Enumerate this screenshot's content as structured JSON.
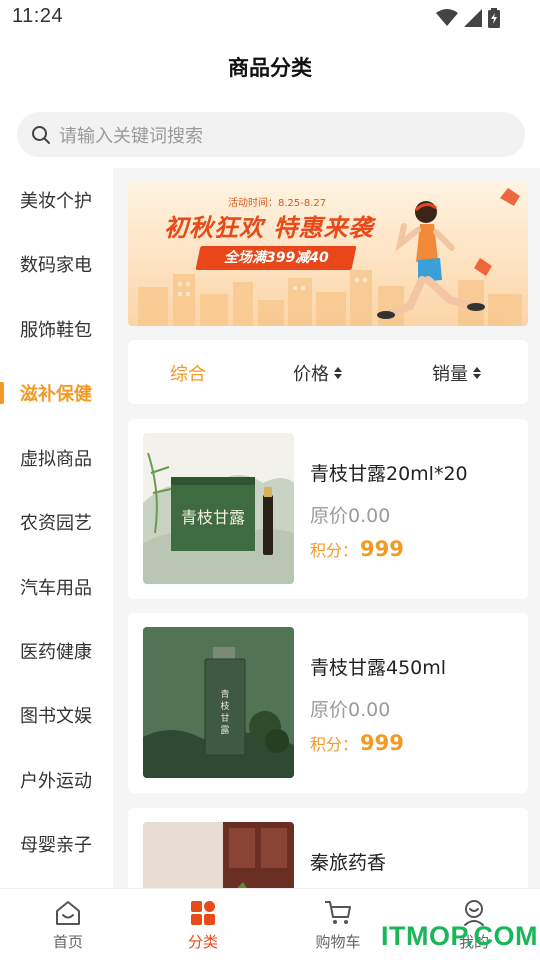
{
  "status": {
    "time": "11:24"
  },
  "header": {
    "title": "商品分类"
  },
  "search": {
    "placeholder": "请输入关键词搜索"
  },
  "sidebar": {
    "items": [
      {
        "label": "美妆个护",
        "active": false
      },
      {
        "label": "数码家电",
        "active": false
      },
      {
        "label": "服饰鞋包",
        "active": false
      },
      {
        "label": "滋补保健",
        "active": true
      },
      {
        "label": "虚拟商品",
        "active": false
      },
      {
        "label": "农资园艺",
        "active": false
      },
      {
        "label": "汽车用品",
        "active": false
      },
      {
        "label": "医药健康",
        "active": false
      },
      {
        "label": "图书文娱",
        "active": false
      },
      {
        "label": "户外运动",
        "active": false
      },
      {
        "label": "母婴亲子",
        "active": false
      }
    ]
  },
  "banner": {
    "date": "活动时间：8.25-8.27",
    "title": "初秋狂欢  特惠来袭",
    "subtitle": "全场满399减40"
  },
  "sort": {
    "tabs": [
      {
        "label": "综合",
        "active": true
      },
      {
        "label": "价格",
        "active": false
      },
      {
        "label": "销量",
        "active": false
      }
    ]
  },
  "products": [
    {
      "name": "青枝甘露20ml*20",
      "orig_price": "原价0.00",
      "points_label": "积分：",
      "points": "999"
    },
    {
      "name": "青枝甘露450ml",
      "orig_price": "原价0.00",
      "points_label": "积分：",
      "points": "999"
    },
    {
      "name": "秦旅药香",
      "orig_price": "",
      "points_label": "",
      "points": ""
    }
  ],
  "bottom_nav": {
    "items": [
      {
        "label": "首页",
        "icon": "home-icon",
        "active": false
      },
      {
        "label": "分类",
        "icon": "category-icon",
        "active": true
      },
      {
        "label": "购物车",
        "icon": "cart-icon",
        "active": false
      },
      {
        "label": "我的",
        "icon": "profile-icon",
        "active": false
      }
    ]
  },
  "watermark": {
    "text": "ITMOP.COM"
  },
  "colors": {
    "accent": "#f29a25",
    "nav_active": "#e84a1a",
    "watermark": "#19b65a"
  }
}
